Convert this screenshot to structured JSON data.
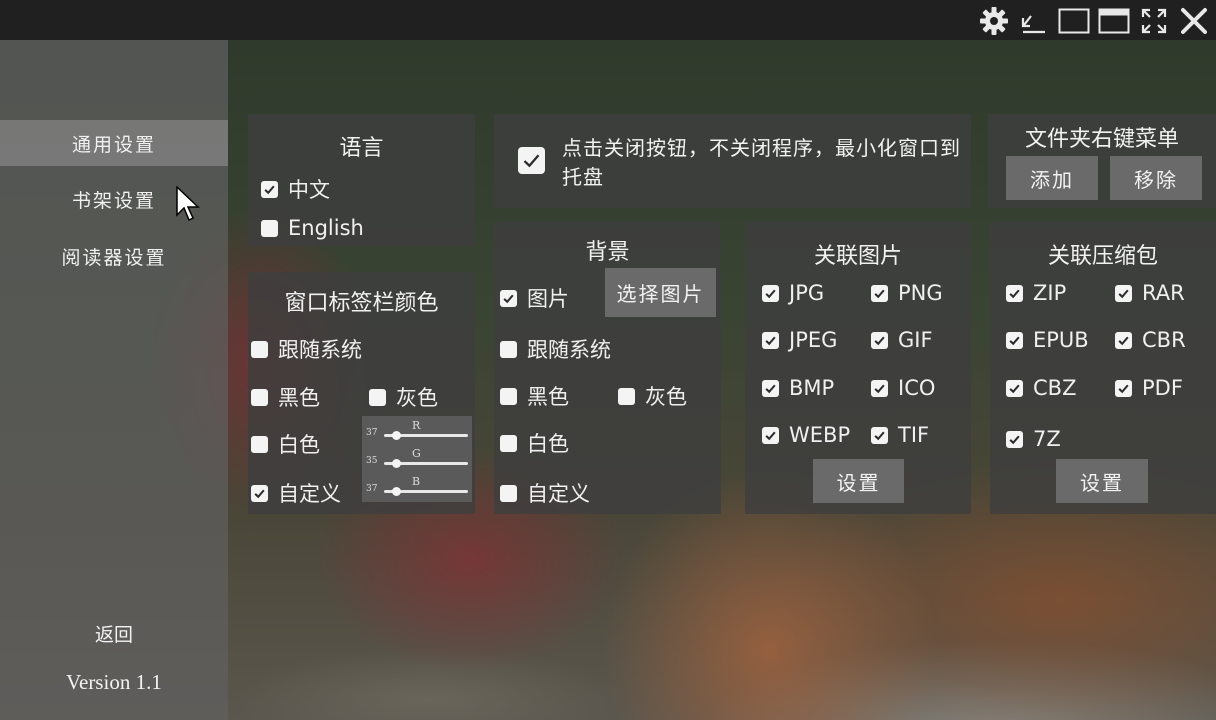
{
  "window": {
    "icons": [
      "gear-icon",
      "shrink-icon",
      "restore-icon",
      "maximize-icon",
      "fullscreen-icon",
      "close-icon"
    ]
  },
  "sidebar": {
    "items": [
      {
        "label": "通用设置",
        "active": true
      },
      {
        "label": "书架设置",
        "active": false
      },
      {
        "label": "阅读器设置",
        "active": false
      }
    ],
    "back_label": "返回",
    "version": "Version 1.1"
  },
  "language": {
    "title": "语言",
    "options": [
      {
        "label": "中文",
        "checked": true
      },
      {
        "label": "English",
        "checked": false
      }
    ]
  },
  "tab_color": {
    "title": "窗口标签栏颜色",
    "follow_system": {
      "label": "跟随系统",
      "checked": false
    },
    "black": {
      "label": "黑色",
      "checked": false
    },
    "gray": {
      "label": "灰色",
      "checked": false
    },
    "white": {
      "label": "白色",
      "checked": false
    },
    "custom": {
      "label": "自定义",
      "checked": true
    },
    "rgb": [
      {
        "label": "R",
        "value": "37"
      },
      {
        "label": "G",
        "value": "35"
      },
      {
        "label": "B",
        "value": "37"
      }
    ]
  },
  "tray": {
    "label": "点击关闭按钮，不关闭程序，最小化窗口到托盘",
    "checked": true
  },
  "context_menu": {
    "title": "文件夹右键菜单",
    "add_label": "添加",
    "remove_label": "移除"
  },
  "background": {
    "title": "背景",
    "image": {
      "label": "图片",
      "checked": true
    },
    "choose_image_label": "选择图片",
    "follow_system": {
      "label": "跟随系统",
      "checked": false
    },
    "black": {
      "label": "黑色",
      "checked": false
    },
    "gray": {
      "label": "灰色",
      "checked": false
    },
    "white": {
      "label": "白色",
      "checked": false
    },
    "custom": {
      "label": "自定义",
      "checked": false
    }
  },
  "image_assoc": {
    "title": "关联图片",
    "formats": [
      {
        "label": "JPG",
        "checked": true
      },
      {
        "label": "PNG",
        "checked": true
      },
      {
        "label": "JPEG",
        "checked": true
      },
      {
        "label": "GIF",
        "checked": true
      },
      {
        "label": "BMP",
        "checked": true
      },
      {
        "label": "ICO",
        "checked": true
      },
      {
        "label": "WEBP",
        "checked": true
      },
      {
        "label": "TIF",
        "checked": true
      }
    ],
    "settings_label": "设置"
  },
  "archive_assoc": {
    "title": "关联压缩包",
    "formats": [
      {
        "label": "ZIP",
        "checked": true
      },
      {
        "label": "RAR",
        "checked": true
      },
      {
        "label": "EPUB",
        "checked": true
      },
      {
        "label": "CBR",
        "checked": true
      },
      {
        "label": "CBZ",
        "checked": true
      },
      {
        "label": "PDF",
        "checked": true
      },
      {
        "label": "7Z",
        "checked": true
      }
    ],
    "settings_label": "设置"
  }
}
